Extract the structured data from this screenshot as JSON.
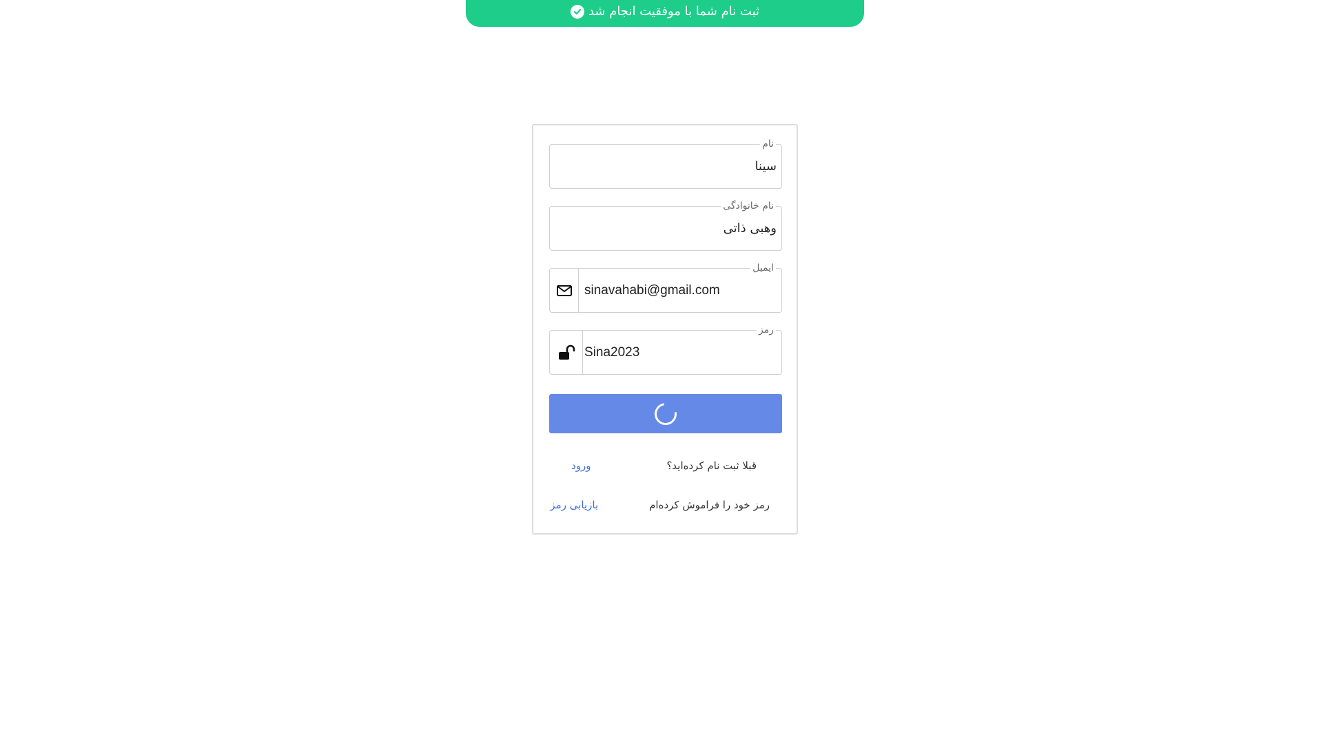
{
  "toast": {
    "message": "ثبت نام شما با موفقیت انجام شد",
    "icon": "check-circle-icon",
    "color": "#1dcd89"
  },
  "form": {
    "first_name": {
      "label": "نام",
      "value": "سینا"
    },
    "last_name": {
      "label": "نام خانوادگی",
      "value": "وهبی ذاتی"
    },
    "email": {
      "label": "ایمیل",
      "value": "sinavahabi@gmail.com",
      "icon": "mail-icon"
    },
    "password": {
      "label": "رمز",
      "value": "Sina2023",
      "icon": "unlock-icon"
    },
    "submit": {
      "state": "loading",
      "color": "#6589e6"
    }
  },
  "links": {
    "login_prompt": "قبلا ثبت نام کرده‌اید؟",
    "login_link": "ورود",
    "forgot_prompt": "رمز خود را فراموش کرده‌ام",
    "forgot_link": "بازیابی رمز",
    "link_color": "#3f6fd8"
  }
}
